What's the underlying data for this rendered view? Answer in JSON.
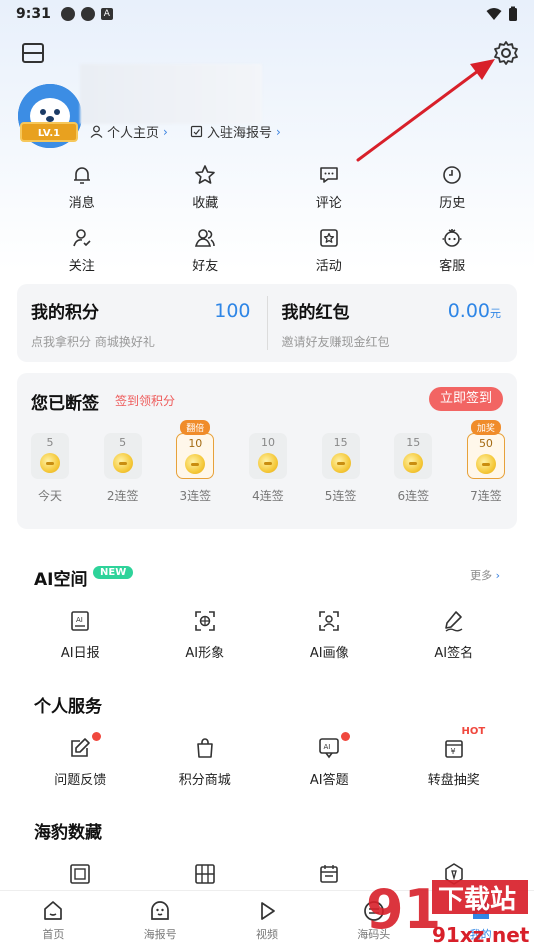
{
  "status_bar": {
    "time": "9:31"
  },
  "profile": {
    "level": "LV.1",
    "links": [
      {
        "label": "个人主页"
      },
      {
        "label": "入驻海报号"
      }
    ]
  },
  "quick_grid": [
    {
      "label": "消息",
      "icon": "bell-icon"
    },
    {
      "label": "收藏",
      "icon": "star-icon"
    },
    {
      "label": "评论",
      "icon": "comment-icon"
    },
    {
      "label": "历史",
      "icon": "clock-icon"
    },
    {
      "label": "关注",
      "icon": "user-follow-icon"
    },
    {
      "label": "好友",
      "icon": "friends-icon"
    },
    {
      "label": "活动",
      "icon": "activity-star-icon"
    },
    {
      "label": "客服",
      "icon": "service-icon"
    }
  ],
  "points": {
    "title": "我的积分",
    "value": "100",
    "sub": "点我拿积分 商城换好礼"
  },
  "red_packet": {
    "title": "我的红包",
    "value": "0.00",
    "unit": "元",
    "sub": "邀请好友赚现金红包"
  },
  "signin": {
    "title": "您已断签",
    "subtitle": "签到领积分",
    "button": "立即签到",
    "days": [
      {
        "points": "5",
        "label": "今天",
        "tag": ""
      },
      {
        "points": "5",
        "label": "2连签",
        "tag": ""
      },
      {
        "points": "10",
        "label": "3连签",
        "tag": "翻倍"
      },
      {
        "points": "10",
        "label": "4连签",
        "tag": ""
      },
      {
        "points": "15",
        "label": "5连签",
        "tag": ""
      },
      {
        "points": "15",
        "label": "6连签",
        "tag": ""
      },
      {
        "points": "50",
        "label": "7连签",
        "tag": "加奖"
      }
    ]
  },
  "ai_space": {
    "title": "AI空间",
    "badge": "NEW",
    "more": "更多",
    "items": [
      {
        "label": "AI日报",
        "icon": "ai-daily-icon"
      },
      {
        "label": "AI形象",
        "icon": "ai-avatar-icon"
      },
      {
        "label": "AI画像",
        "icon": "ai-portrait-icon"
      },
      {
        "label": "AI签名",
        "icon": "ai-signature-icon"
      }
    ]
  },
  "personal_services": {
    "title": "个人服务",
    "items": [
      {
        "label": "问题反馈",
        "icon": "feedback-icon"
      },
      {
        "label": "积分商城",
        "icon": "shopping-bag-icon"
      },
      {
        "label": "AI答题",
        "icon": "ai-quiz-icon"
      },
      {
        "label": "转盘抽奖",
        "icon": "lottery-icon",
        "badge": "HOT"
      }
    ]
  },
  "collections": {
    "title": "海豹数藏"
  },
  "tabbar": [
    {
      "label": "首页",
      "icon": "home-icon"
    },
    {
      "label": "海报号",
      "icon": "poster-icon"
    },
    {
      "label": "视频",
      "icon": "play-icon"
    },
    {
      "label": "海码头",
      "icon": "dock-icon"
    },
    {
      "label": "我的",
      "icon": "me-icon"
    }
  ],
  "watermark": {
    "brand": "下载站",
    "domain": "91xz.net"
  },
  "colors": {
    "accent_blue": "#2f86e6",
    "signin_red": "#f26563",
    "arrow_red": "#d8202a"
  }
}
